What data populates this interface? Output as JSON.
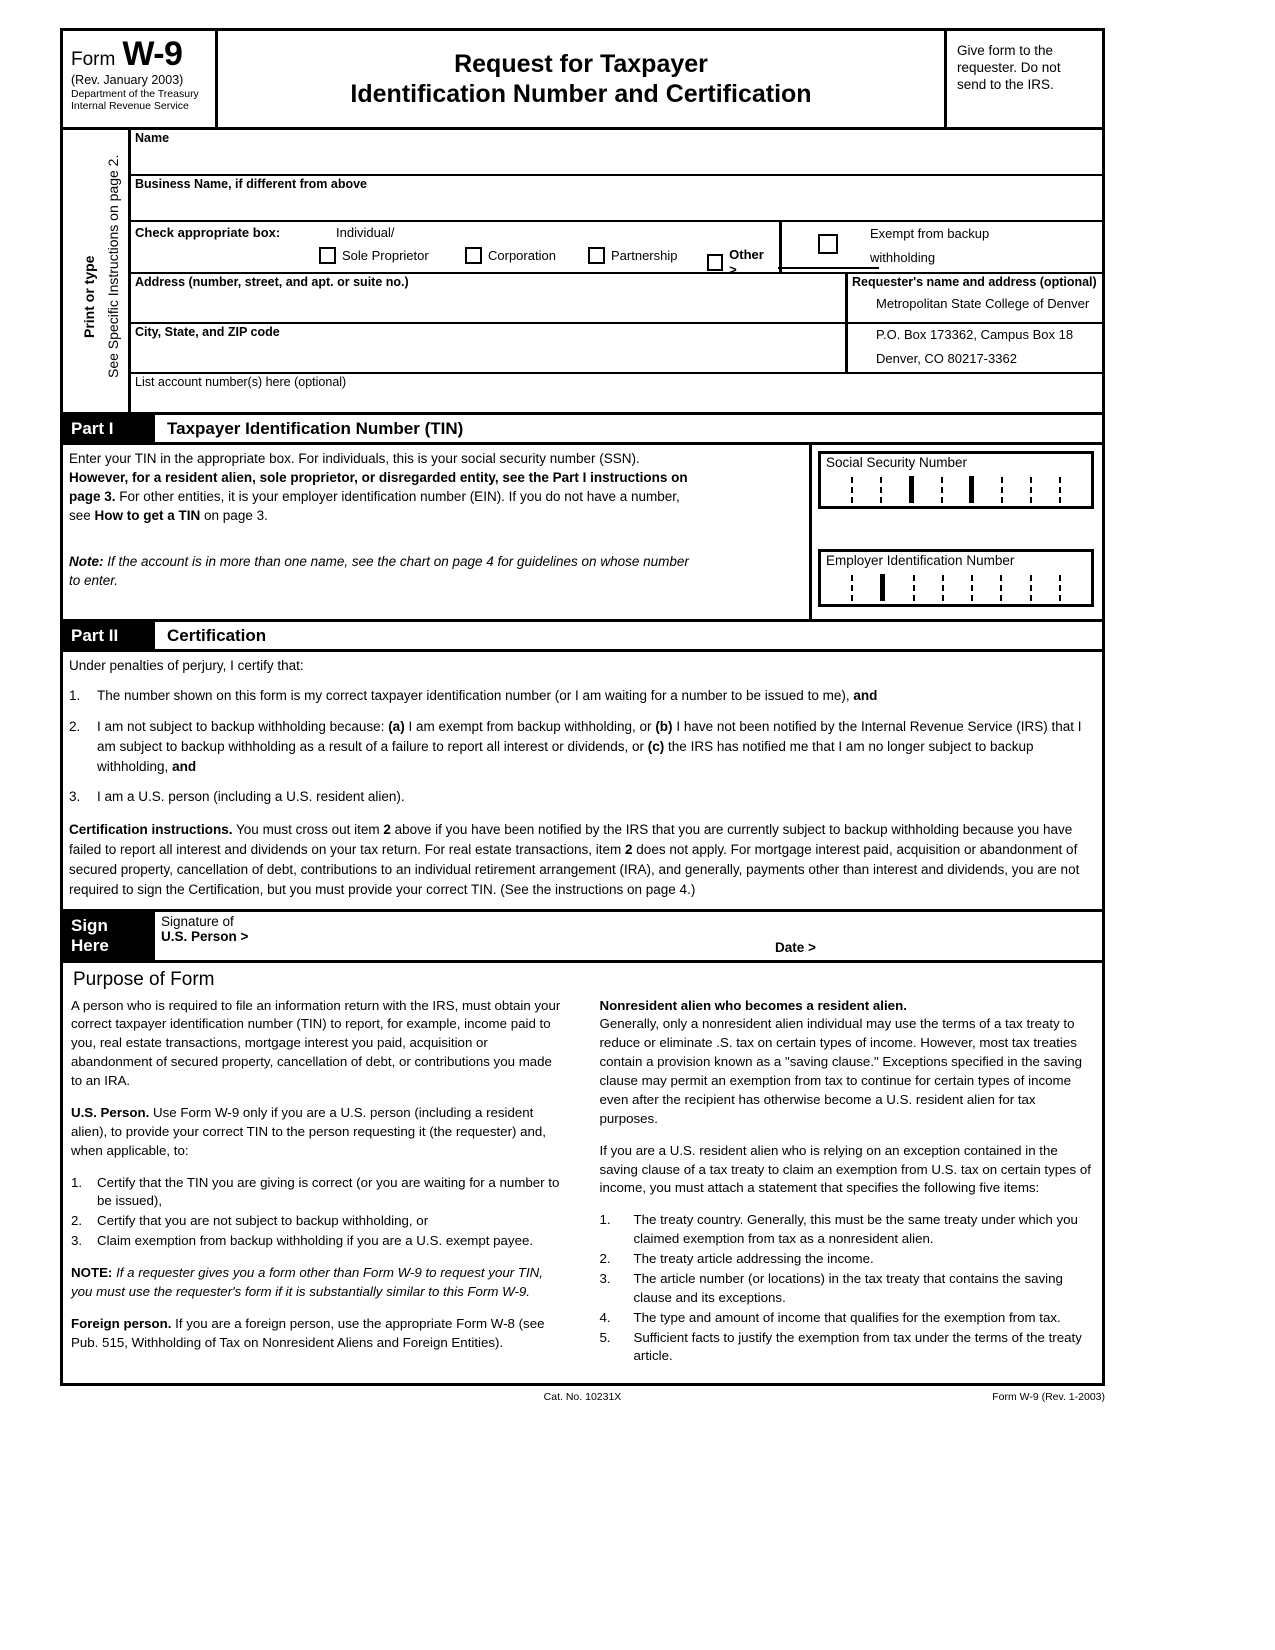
{
  "header": {
    "form_word": "Form",
    "form_number": "W-9",
    "revision": "(Rev. January 2003)",
    "dept_line1": "Department of the Treasury",
    "dept_line2": "Internal Revenue Service",
    "title_line1": "Request for Taxpayer",
    "title_line2": "Identification Number and Certification",
    "give_form_line1": "Give form to the",
    "give_form_line2": "requester.  Do not",
    "give_form_line3": "send to the IRS."
  },
  "sidebar": {
    "print_or_type": "Print or type",
    "see_instructions": "See Specific Instructions on page 2."
  },
  "fields": {
    "name_label": "Name",
    "business_name_label": "Business Name, if different from above",
    "check_box_label": "Check appropriate box:",
    "individual_label": "Individual/",
    "sole_proprietor_label": "Sole Proprietor",
    "corporation_label": "Corporation",
    "partnership_label": "Partnership",
    "other_label": "Other >",
    "exempt_line1": "Exempt from backup",
    "exempt_line2": "withholding",
    "address_label": "Address (number, street, and apt. or suite no.)",
    "city_label": "City, State, and ZIP code",
    "account_label": "List account number(s) here (optional)",
    "requester_label": "Requester's name and address (optional)",
    "requester_line1": "Metropolitan State College of Denver",
    "requester_line2": "P.O. Box 173362, Campus Box 18",
    "requester_line3": "Denver, CO   80217-3362"
  },
  "part1": {
    "tag": "Part I",
    "title": "Taxpayer Identification Number (TIN)",
    "p1_a": "Enter your TIN in the appropriate box.  For individuals, this is your social security number (SSN).",
    "p1_b": "However, for a resident alien, sole proprietor, or disregarded entity, see the Part I instructions on",
    "p1_c_bold": "page 3.",
    "p1_c": " For other entities, it is your employer identification number (EIN).  If you do not have a number,",
    "p1_d_pre": "see ",
    "p1_d_bold": "How to get a TIN",
    "p1_d_post": " on page 3.",
    "note_label": "Note:",
    "note_text": "  If the account is in more than one name, see the chart on page 4 for guidelines on whose number",
    "note_text2": "to enter.",
    "ssn_label": "Social Security Number",
    "ein_label": "Employer Identification Number"
  },
  "part2": {
    "tag": "Part II",
    "title": "Certification",
    "intro": "Under penalties of perjury, I certify that:",
    "items": [
      {
        "n": "1.",
        "text": "The number shown on this form is my correct taxpayer identification number (or I am waiting for a number to be issued to me), ",
        "bold_tail": "and"
      },
      {
        "n": "2.",
        "text": "I am not subject to backup withholding because: (a) I am exempt from backup withholding, or (b) I have not been notified by the Internal Revenue Service (IRS) that I am subject to backup withholding as a result of a failure to report all interest or dividends, or (c) the IRS has notified me that I am no longer subject to backup withholding, and"
      },
      {
        "n": "3.",
        "text": "I am a U.S. person (including a U.S. resident alien)."
      }
    ],
    "cert_heading": "Certification instructions.",
    "cert_body": "  You must cross out item 2 above if you have been notified by the IRS that you are currently subject to backup withholding because you have failed to report all interest and dividends on your tax return.  For real estate transactions, item 2 does not apply. For mortgage interest paid, acquisition or abandonment of secured property, cancellation of debt, contributions to an individual retirement arrangement (IRA), and generally, payments other than interest and dividends, you are not required to sign the Certification, but you must provide your correct TIN.  (See the instructions on page 4.)"
  },
  "sign": {
    "tag_line1": "Sign",
    "tag_line2": "Here",
    "signature_line1": "Signature of",
    "signature_line2": "U.S. Person >",
    "date_label": "Date >"
  },
  "purpose": {
    "heading": "Purpose of Form",
    "left": {
      "p1": "A person who is required to file an information return with the IRS, must obtain your correct taxpayer identification number (TIN) to report, for example, income paid to you, real estate transactions, mortgage interest you paid, acquisition or abandonment of secured property, cancellation of debt, or contributions you made to an IRA.",
      "p2_bold": "U.S. Person.",
      "p2": "  Use Form W-9 only if you are a U.S. person (including a resident alien), to provide your correct TIN to the person requesting it (the requester) and, when applicable, to:",
      "list": [
        {
          "n": "1.",
          "t": "Certify that the TIN you are giving is correct (or you are waiting for a number to be issued),"
        },
        {
          "n": "2.",
          "t": "Certify that you are not subject to backup withholding, or"
        },
        {
          "n": "3.",
          "t": "Claim exemption from backup withholding if you are a U.S. exempt payee."
        }
      ],
      "note_bold": "NOTE:",
      "note": "  If a requester gives you a form other than Form W-9 to request your TIN, you must use the requester's form if it is substantially similar to this Form W-9.",
      "foreign_bold": "Foreign person.",
      "foreign": "  If you are a foreign person, use the appropriate Form W-8 (see Pub. 515, Withholding of Tax on Nonresident Aliens and Foreign Entities)."
    },
    "right": {
      "h_bold": "Nonresident alien who becomes a resident alien.",
      "p1": "Generally, only a nonresident alien individual may use the terms of a tax treaty to reduce or eliminate .S. tax on certain types of income.  However, most tax treaties contain a provision known as a \"saving clause.\"  Exceptions specified in the saving clause may permit an exemption from tax to continue for certain types of income even after the recipient has otherwise become a U.S. resident alien for tax purposes.",
      "p2": "If you are a U.S. resident alien who is relying on an exception contained in the saving clause of a tax treaty to claim an exemption from U.S. tax on certain types of income, you must attach a statement that specifies the following five items:",
      "list": [
        {
          "n": "1.",
          "t": "The treaty country.  Generally, this must be the same treaty under which you claimed exemption from tax as a nonresident alien."
        },
        {
          "n": "2.",
          "t": "The treaty article addressing the income."
        },
        {
          "n": "3.",
          "t": "The article number (or locations) in the tax treaty that contains the saving clause and its exceptions."
        },
        {
          "n": "4.",
          "t": "The type and amount of income that qualifies for the exemption from tax."
        },
        {
          "n": "5.",
          "t": "Sufficient facts to justify the exemption from tax under the terms of the treaty article."
        }
      ]
    }
  },
  "footer": {
    "cat_no": "Cat. No. 10231X",
    "form_rev": "Form W-9 (Rev. 1-2003)"
  }
}
